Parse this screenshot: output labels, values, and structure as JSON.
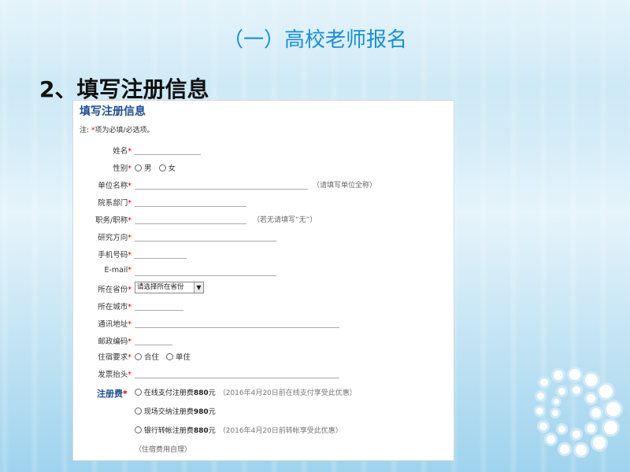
{
  "slide": {
    "heading": "（一）高校老师报名",
    "subheading": "2、填写注册信息"
  },
  "form": {
    "title": "填写注册信息",
    "note_prefix": "注: ",
    "note_star": "*",
    "note_text": "项为必填/必选项。",
    "required_mark": "*",
    "fields": {
      "name": "姓名",
      "gender": "性别",
      "gender_male": "男",
      "gender_female": "女",
      "unit": "单位名称",
      "unit_hint": "（请填写单位全称）",
      "department": "院系部门",
      "title": "职务/职称",
      "title_hint": "（若无请填写“无”）",
      "research": "研究方向",
      "phone": "手机号码",
      "email": "E-mail",
      "province": "所在省份",
      "province_select": "请选择所在省份",
      "city": "所在城市",
      "address": "通讯地址",
      "postcode": "邮政编码",
      "lodging": "住宿要求",
      "lodging_shared": "合住",
      "lodging_single": "单住",
      "invoice": "发票抬头"
    },
    "fee": {
      "label": "注册费",
      "options": [
        {
          "text_a": "在线支付注册费",
          "amount": "880",
          "unit": "元",
          "note": "（2016年4月20日前在线支付享受此优惠）"
        },
        {
          "text_a": "现场交纳注册费",
          "amount": "980",
          "unit": "元",
          "note": ""
        },
        {
          "text_a": "银行转帐注册费",
          "amount": "880",
          "unit": "元",
          "note": "（2016年4月20日前转帐享受此优惠）"
        }
      ],
      "footnote": "（住宿费用自理）"
    }
  }
}
